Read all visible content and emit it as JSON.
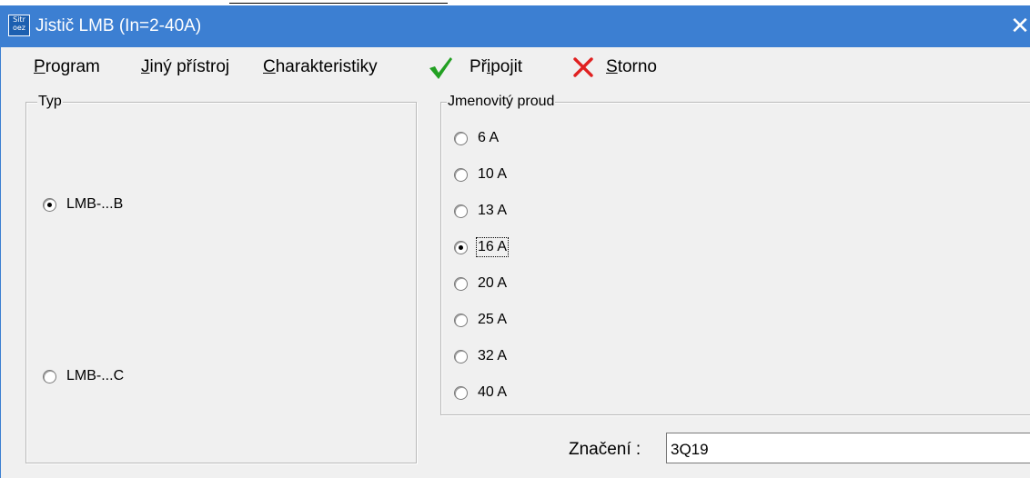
{
  "window": {
    "title": "Jistič LMB (In=2-40A)",
    "icon_line1": "Sitr",
    "icon_line2": "oez",
    "close_glyph": "✕",
    "accent_color": "#3c7fd2"
  },
  "menu": {
    "program": {
      "mnemonic": "P",
      "rest": "rogram"
    },
    "jiny": {
      "mnemonic": "J",
      "rest": "iný přístroj"
    },
    "charakteristiky": {
      "mnemonic": "C",
      "rest": "harakteristiky"
    },
    "pripojit": {
      "pre": "Př",
      "mnemonic": "i",
      "rest": "pojit",
      "icon": "check-icon",
      "icon_color": "#22a022"
    },
    "storno": {
      "mnemonic": "S",
      "rest": "torno",
      "icon": "cross-icon",
      "icon_color": "#e02020"
    }
  },
  "typ_group": {
    "legend": "Typ",
    "options": [
      {
        "label": "LMB-...B",
        "checked": true
      },
      {
        "label": "LMB-...C",
        "checked": false
      }
    ]
  },
  "proud_group": {
    "legend": "Jmenovitý proud",
    "options": [
      {
        "label": "6 A",
        "checked": false
      },
      {
        "label": "10 A",
        "checked": false
      },
      {
        "label": "13 A",
        "checked": false
      },
      {
        "label": "16 A",
        "checked": true
      },
      {
        "label": "20 A",
        "checked": false
      },
      {
        "label": "25 A",
        "checked": false
      },
      {
        "label": "32 A",
        "checked": false
      },
      {
        "label": "40 A",
        "checked": false
      }
    ]
  },
  "znaceni": {
    "label": "Značení :",
    "value": "3Q19"
  }
}
